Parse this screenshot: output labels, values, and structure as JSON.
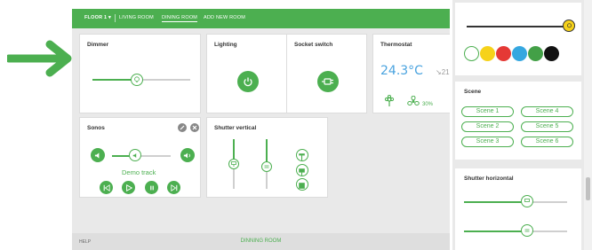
{
  "nav": {
    "floor": "FLOOR 1",
    "items": [
      "LIVING ROOM",
      "DINING ROOM",
      "ADD NEW ROOM"
    ],
    "selected": "DINING ROOM"
  },
  "cards": {
    "dimmer": {
      "title": "Dimmer",
      "level": 0.5
    },
    "lighting": {
      "title": "Lighting"
    },
    "socket": {
      "title": "Socket switch"
    },
    "thermostat": {
      "title": "Thermostat",
      "temp": "24.3°C",
      "setpoint": "↘21",
      "humidity": "30%"
    },
    "sonos": {
      "title": "Sonos",
      "track": "Demo track",
      "volume": 0.4
    },
    "shutter_vertical": {
      "title": "Shutter vertical"
    }
  },
  "footer": {
    "help": "HELP",
    "room": "DINNING ROOM"
  },
  "right": {
    "colors": [
      "#ffffff",
      "#f6d21a",
      "#e53935",
      "#35a7e0",
      "#43a047",
      "#111111"
    ],
    "scene": {
      "title": "Scene",
      "buttons": [
        "Scene 1",
        "Scene 4",
        "Scene 2",
        "Scene 5",
        "Scene 3",
        "Scene 6"
      ]
    },
    "shutter_horizontal": {
      "title": "Shutter horizontal"
    }
  },
  "accent": "#4caf50"
}
